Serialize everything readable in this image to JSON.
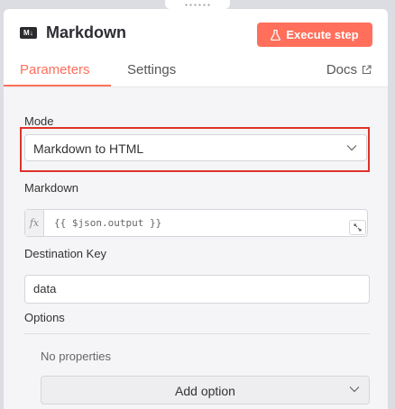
{
  "node": {
    "icon": "markdown-icon",
    "icon_text": "M↓",
    "title": "Markdown",
    "execute_label": "Execute step",
    "execute_icon": "flask-icon"
  },
  "tabs": [
    {
      "label": "Parameters",
      "active": true
    },
    {
      "label": "Settings",
      "active": false
    },
    {
      "label": "Docs",
      "active": false,
      "icon": "external-link-icon"
    }
  ],
  "params": {
    "mode_label": "Mode",
    "mode_value": "Markdown to HTML",
    "markdown_label": "Markdown",
    "markdown_fx": "fx",
    "markdown_expression": "{{ $json.output }}",
    "destination_label": "Destination Key",
    "destination_value": "data",
    "options_label": "Options",
    "no_properties": "No properties",
    "add_option_label": "Add option"
  },
  "colors": {
    "accent": "#ff6f5b",
    "highlight": "#e0332a"
  }
}
